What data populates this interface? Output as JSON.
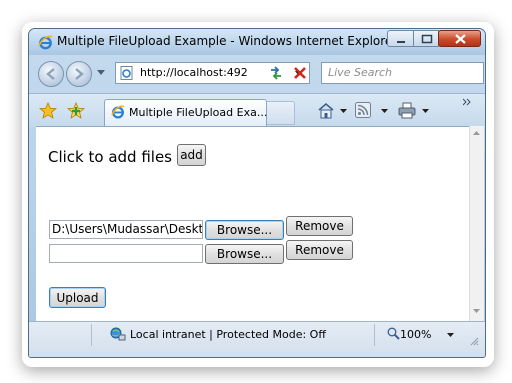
{
  "window": {
    "title": "Multiple FileUpload Example - Windows Internet Explorer"
  },
  "navbar": {
    "address": "http://localhost:492",
    "search_placeholder": "Live Search"
  },
  "tabs": [
    {
      "label": "Multiple FileUpload Exa..."
    }
  ],
  "page": {
    "click_label": "Click to add files",
    "add_button": "add",
    "file_rows": [
      {
        "value": "D:\\Users\\Mudassar\\Deskt",
        "browse_label": "Browse...",
        "remove_label": "Remove"
      },
      {
        "value": "",
        "browse_label": "Browse...",
        "remove_label": "Remove"
      }
    ],
    "upload_button": "Upload"
  },
  "status": {
    "zone": "Local intranet | Protected Mode: Off",
    "zoom": "100%"
  },
  "icons": {
    "browser": "ie-logo-icon",
    "favorites": "favorites-star-icon",
    "add_favorites": "add-favorites-icon",
    "home": "home-icon",
    "feeds": "feeds-icon",
    "print": "print-icon",
    "refresh": "refresh-icon",
    "stop": "stop-icon",
    "zone": "local-intranet-icon",
    "zoom": "zoom-icon"
  },
  "colors": {
    "frame": "#a9c7e2",
    "close_button": "#c84c2d",
    "focus_border": "#3c7fb1"
  }
}
